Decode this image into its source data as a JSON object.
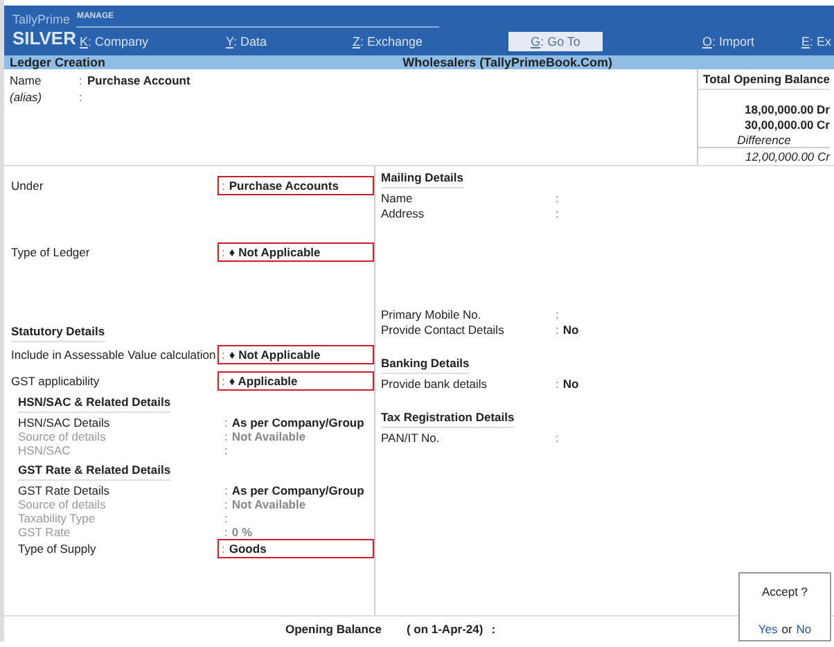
{
  "brand": {
    "product": "TallyPrime",
    "edition": "SILVER"
  },
  "menu": {
    "group": "MANAGE",
    "items": [
      {
        "key": "K",
        "label": ": Company",
        "disabled": false
      },
      {
        "key": "Y",
        "label": ": Data",
        "disabled": false
      },
      {
        "key": "Z",
        "label": ": Exchange",
        "disabled": false
      },
      {
        "key": "G",
        "label": ": Go To",
        "disabled": true
      },
      {
        "key": "O",
        "label": ": Import",
        "disabled": false
      },
      {
        "key": "E",
        "label": ": Ex",
        "disabled": false
      }
    ]
  },
  "header": {
    "title": "Ledger Creation",
    "company": "Wholesalers (TallyPrimeBook.Com)"
  },
  "name_fields": [
    {
      "label": "Name",
      "sep": ":",
      "value": "Purchase Account",
      "italic": false
    },
    {
      "label": "(alias)",
      "sep": ":",
      "italic": true
    }
  ],
  "balance": {
    "title": "Total Opening Balance",
    "debit": "18,00,000.00 Dr",
    "credit": "30,00,000.00 Cr",
    "difference_label": "Difference",
    "difference": "12,00,000.00 Cr"
  },
  "left_sections": [
    {
      "fields": [
        {
          "label": "Under",
          "sep": ":",
          "value": "Purchase Accounts",
          "dim": false,
          "highlighted": true
        }
      ]
    },
    {
      "fields": [
        {
          "label": "Type of Ledger",
          "sep": ":",
          "value": "♦ Not Applicable",
          "dim": false,
          "highlighted": true
        }
      ]
    },
    {
      "heading": "Statutory Details",
      "fields": [
        {
          "label": "Include in Assessable Value calculation",
          "sep": ":",
          "value": "♦ Not Applicable",
          "dim": false,
          "highlighted": true
        },
        {
          "label": "GST applicability",
          "sep": ":",
          "value": "♦ Applicable",
          "dim": false,
          "highlighted": true
        }
      ]
    },
    {
      "heading": "HSN/SAC & Related Details",
      "fields": [
        {
          "label": "HSN/SAC Details",
          "sep": ":",
          "value": "As per Company/Group",
          "dim": false,
          "highlighted": false
        },
        {
          "label": "Source of details",
          "sep": ":",
          "value": "Not Available",
          "dim": true,
          "highlighted": false
        },
        {
          "label": "HSN/SAC",
          "sep": ":",
          "dim": true,
          "highlighted": false
        }
      ]
    },
    {
      "heading": "GST Rate & Related Details",
      "fields": [
        {
          "label": "GST Rate Details",
          "sep": ":",
          "value": "As per Company/Group",
          "dim": false,
          "highlighted": false
        },
        {
          "label": "Source of details",
          "sep": ":",
          "value": "Not Available",
          "dim": true,
          "highlighted": false
        },
        {
          "label": "Taxability Type",
          "sep": ":",
          "dim": true,
          "highlighted": false
        },
        {
          "label": "GST Rate",
          "sep": ":",
          "value": "0 %",
          "dim": true,
          "highlighted": false
        },
        {
          "label": "Type of Supply",
          "sep": ":",
          "value": "Goods",
          "dim": false,
          "highlighted": true
        }
      ]
    }
  ],
  "right_sections": [
    {
      "heading": "Mailing Details",
      "fields": [
        {
          "label": "Name",
          "sep": ":"
        },
        {
          "label": "Address",
          "sep": ":"
        }
      ]
    },
    {
      "fields": [
        {
          "label": "Primary Mobile No.",
          "sep": ":"
        },
        {
          "label": "Provide Contact Details",
          "sep": ":",
          "value": "No"
        }
      ]
    },
    {
      "heading": "Banking Details",
      "fields": [
        {
          "label": "Provide bank details",
          "sep": ":",
          "value": "No"
        }
      ]
    },
    {
      "heading": "Tax Registration Details",
      "fields": [
        {
          "label": "PAN/IT No.",
          "sep": ":"
        }
      ]
    }
  ],
  "footer": {
    "label": "Opening Balance",
    "date": "( on 1-Apr-24)",
    "sep": ":"
  },
  "accept": {
    "question": "Accept ?",
    "yes": "Yes",
    "or": "or",
    "no": "No"
  }
}
